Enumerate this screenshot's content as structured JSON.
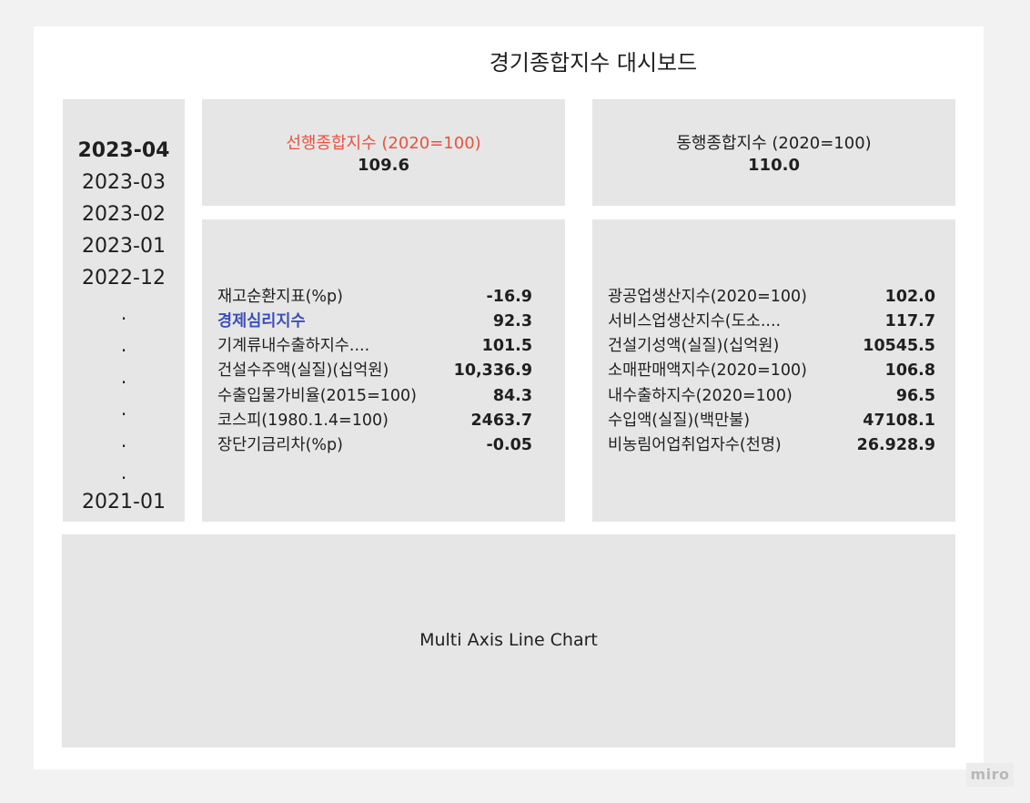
{
  "title": "경기종합지수 대시보드",
  "dates": {
    "items": [
      "2023-04",
      "2023-03",
      "2023-02",
      "2023-01",
      "2022-12"
    ],
    "active": "2023-04",
    "ellipsis": [
      ".",
      ".",
      ".",
      ".",
      ".",
      "."
    ],
    "last": "2021-01"
  },
  "leading_index": {
    "label": "선행종합지수 (2020=100)",
    "value": "109.6",
    "label_color": "#e8533f"
  },
  "coincident_index": {
    "label": "동행종합지수 (2020=100)",
    "value": "110.0"
  },
  "leading_components": [
    {
      "name": "재고순환지표(%p)",
      "value": "-16.9"
    },
    {
      "name": "경제심리지수",
      "value": "92.3",
      "highlight": true
    },
    {
      "name": "기계류내수출하지수....",
      "value": "101.5"
    },
    {
      "name": "건설수주액(실질)(십억원)",
      "value": "10,336.9"
    },
    {
      "name": "수출입물가비율(2015=100)",
      "value": "84.3"
    },
    {
      "name": "코스피(1980.1.4=100)",
      "value": "2463.7"
    },
    {
      "name": "장단기금리차(%p)",
      "value": "-0.05"
    }
  ],
  "coincident_components": [
    {
      "name": "광공업생산지수(2020=100)",
      "value": "102.0"
    },
    {
      "name": "서비스업생산지수(도소....",
      "value": "117.7"
    },
    {
      "name": "건설기성액(실질)(십억원)",
      "value": "10545.5"
    },
    {
      "name": "소매판매액지수(2020=100)",
      "value": "106.8"
    },
    {
      "name": "내수출하지수(2020=100)",
      "value": "96.5"
    },
    {
      "name": "수입액(실질)(백만불)",
      "value": "47108.1"
    },
    {
      "name": "비농림어업취업자수(천명)",
      "value": "26.928.9"
    }
  ],
  "chart_placeholder": "Multi Axis Line Chart",
  "highlight_color": "#3b4fb8",
  "watermark": "miro"
}
